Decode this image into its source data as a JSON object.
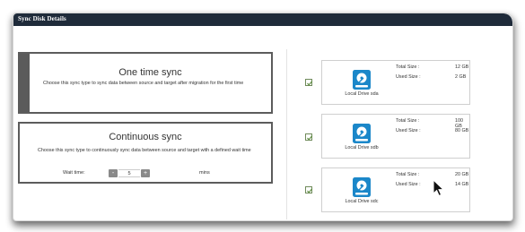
{
  "window": {
    "title": "Sync Disk Details"
  },
  "sync_options": [
    {
      "title": "One time sync",
      "description": "Choose this sync type to sync data between source and target after migration for the first time",
      "selected": true
    },
    {
      "title": "Continuous sync",
      "description": "Choose this sync type to continuously sync data between source and target with a defined wait time",
      "selected": false,
      "wait": {
        "label": "Wait time:",
        "minus": "-",
        "value": "5",
        "plus": "+",
        "unit": "mins"
      }
    }
  ],
  "drives": [
    {
      "name": "Local Drive sda",
      "checked": true,
      "total_label": "Total Size :",
      "total_value": "12  GB",
      "used_label": "Used Size :",
      "used_value": "2 GB"
    },
    {
      "name": "Local Drive sdb",
      "checked": true,
      "total_label": "Total Size :",
      "total_value": "100  GB",
      "used_label": "Used Size :",
      "used_value": "80 GB"
    },
    {
      "name": "Local Drive sdc",
      "checked": true,
      "total_label": "Total Size :",
      "total_value": "20  GB",
      "used_label": "Used Size :",
      "used_value": "14 GB"
    }
  ],
  "colors": {
    "titlebar": "#1f2b3a",
    "drive_icon": "#1b87c9",
    "check": "#5a8a3c"
  },
  "icons": {
    "drive": "hard-drive-icon",
    "check": "checkbox-checked-icon",
    "cursor": "mouse-pointer-icon"
  }
}
